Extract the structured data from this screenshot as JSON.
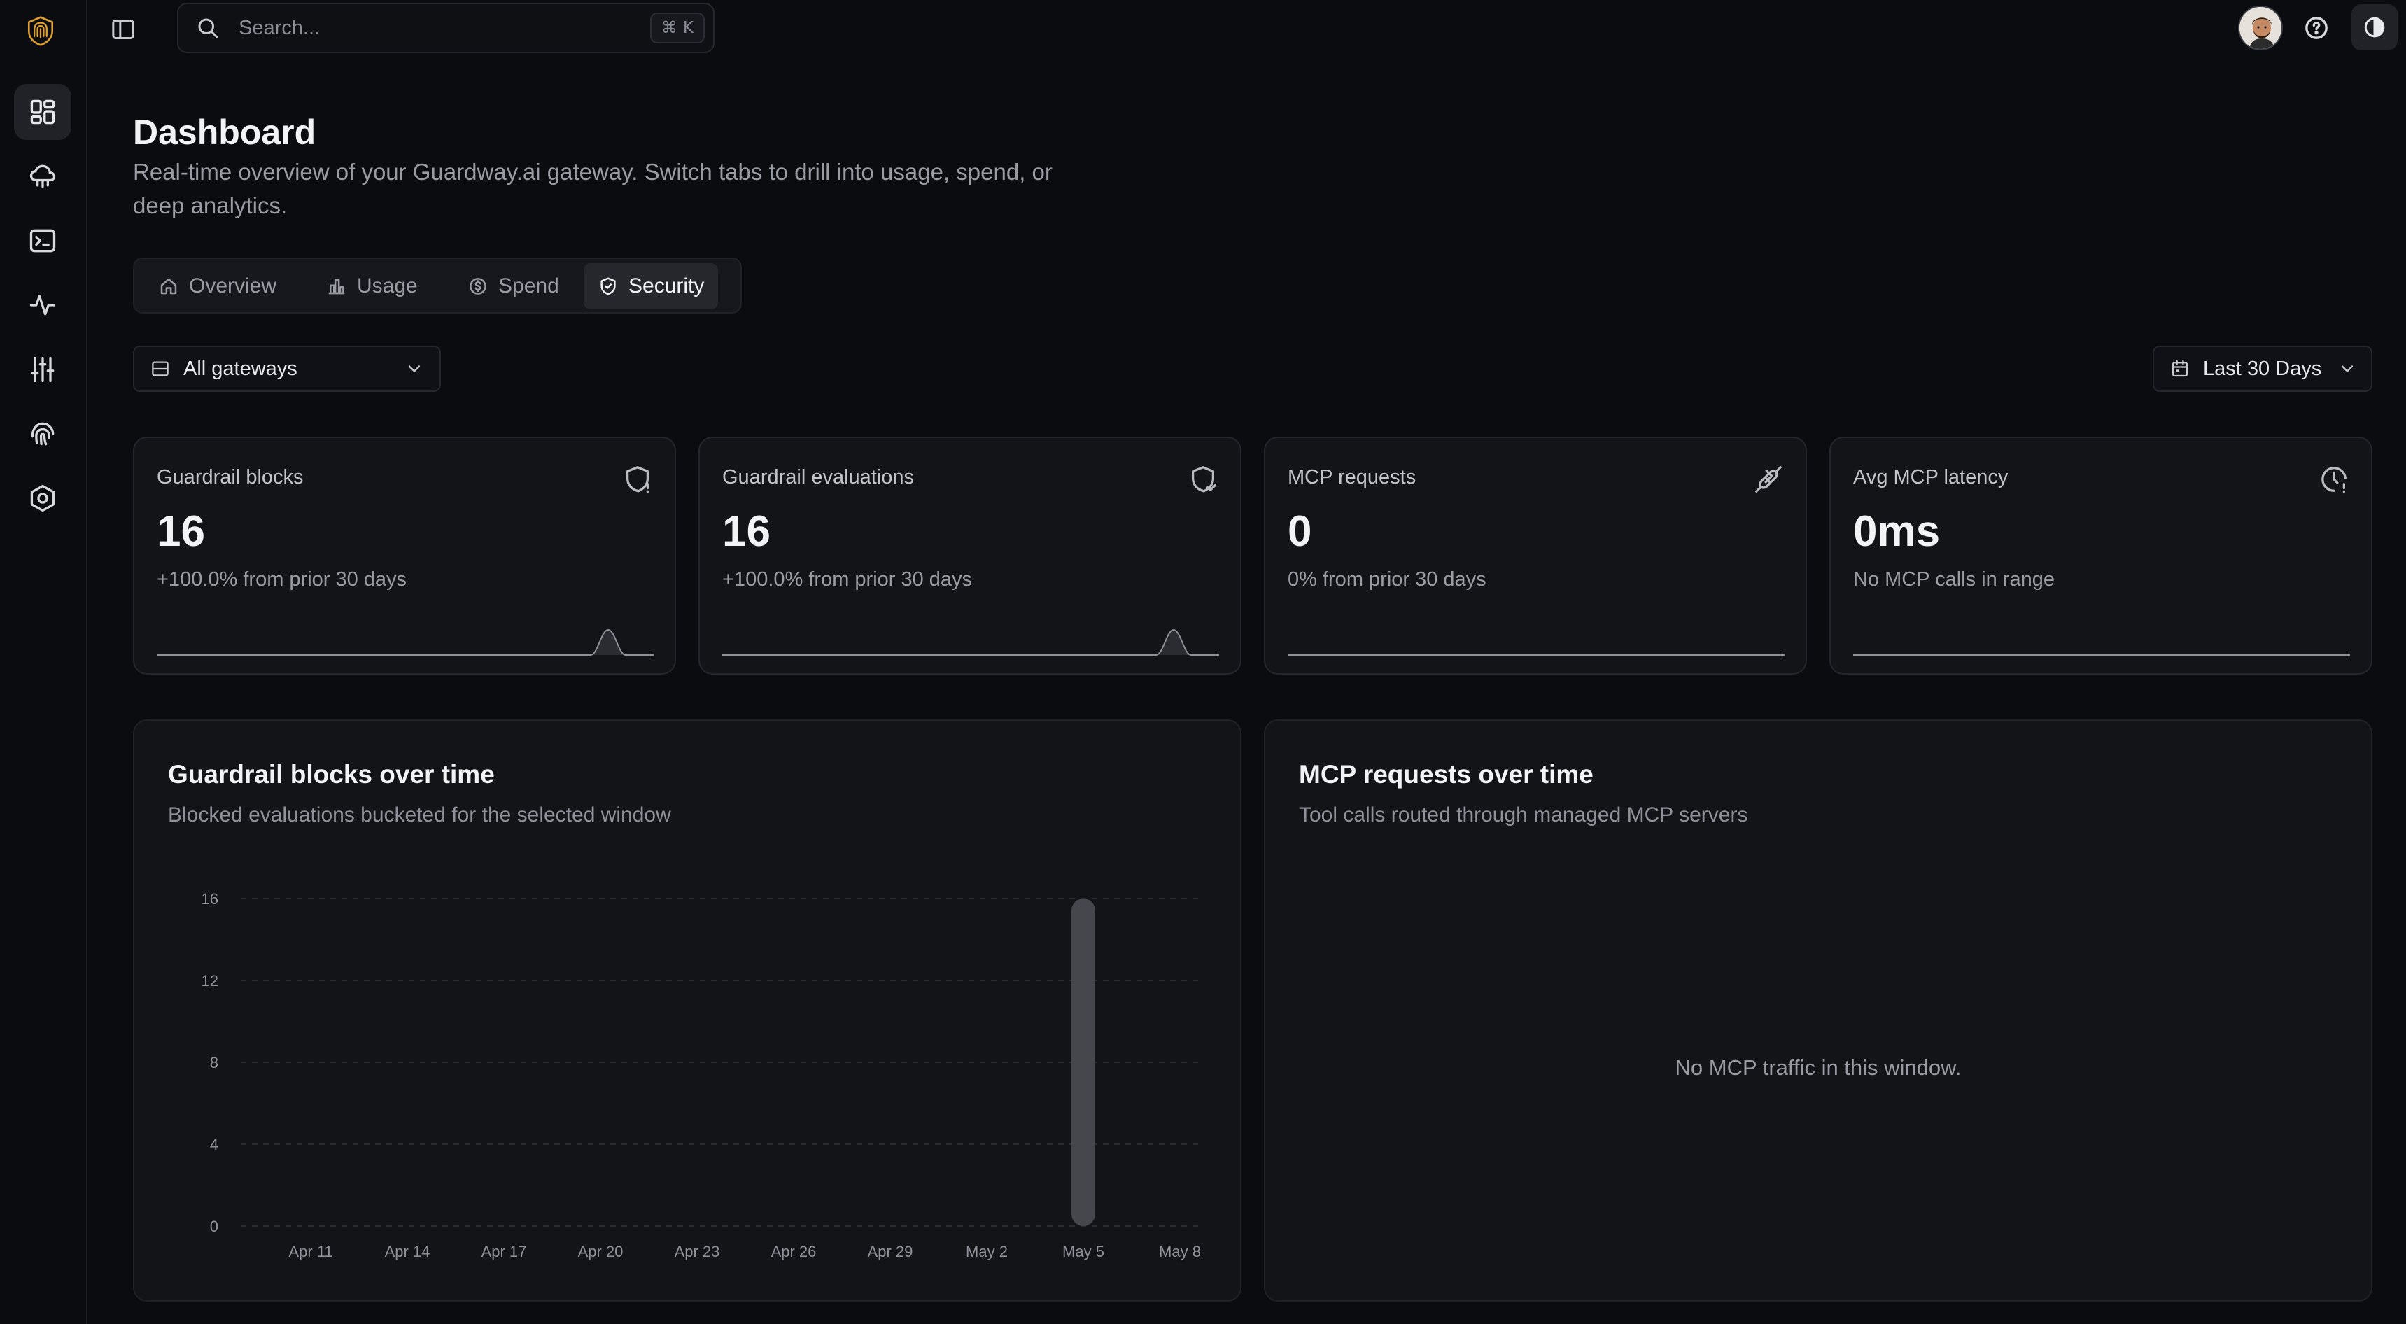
{
  "app": {
    "search_placeholder": "Search...",
    "search_shortcut_symbol": "⌘",
    "search_shortcut_key": "K"
  },
  "nav": {
    "items": [
      {
        "icon": "dashboard-grid-icon",
        "active": true
      },
      {
        "icon": "cloud-network-icon",
        "active": false
      },
      {
        "icon": "terminal-icon",
        "active": false
      },
      {
        "icon": "activity-icon",
        "active": false
      },
      {
        "icon": "sliders-icon",
        "active": false
      },
      {
        "icon": "fingerprint-icon",
        "active": false
      },
      {
        "icon": "hexagon-settings-icon",
        "active": false
      }
    ]
  },
  "header": {
    "title": "Dashboard",
    "subtitle": "Real-time overview of your Guardway.ai gateway. Switch tabs to drill into usage, spend, or deep analytics."
  },
  "tabs": [
    {
      "label": "Overview",
      "icon": "home-icon",
      "active": false
    },
    {
      "label": "Usage",
      "icon": "bar-chart-icon",
      "active": false
    },
    {
      "label": "Spend",
      "icon": "dollar-circle-icon",
      "active": false
    },
    {
      "label": "Security",
      "icon": "shield-icon",
      "active": true
    }
  ],
  "filters": {
    "gateway": "All gateways",
    "date_range": "Last 30 Days"
  },
  "kpis": [
    {
      "label": "Guardrail blocks",
      "value": "16",
      "delta": "+100.0% from prior 30 days",
      "icon": "shield-alert-icon"
    },
    {
      "label": "Guardrail evaluations",
      "value": "16",
      "delta": "+100.0% from prior 30 days",
      "icon": "shield-check-icon"
    },
    {
      "label": "MCP requests",
      "value": "0",
      "delta": "0% from prior 30 days",
      "icon": "plug-icon"
    },
    {
      "label": "Avg MCP latency",
      "value": "0ms",
      "delta": "No MCP calls in range",
      "icon": "clock-alert-icon"
    }
  ],
  "panels": {
    "blocks": {
      "title": "Guardrail blocks over time",
      "subtitle": "Blocked evaluations bucketed for the selected window"
    },
    "mcp": {
      "title": "MCP requests over time",
      "subtitle": "Tool calls routed through managed MCP servers",
      "empty_message": "No MCP traffic in this window."
    }
  },
  "colors": {
    "background": "#0b0c0f",
    "card": "#131418",
    "accent_logo": "#e0a030",
    "bar": "#45474d"
  },
  "chart_data": [
    {
      "type": "bar",
      "title": "Guardrail blocks over time",
      "categories": [
        "Apr 11",
        "Apr 14",
        "Apr 17",
        "Apr 20",
        "Apr 23",
        "Apr 26",
        "Apr 29",
        "May 2",
        "May 5",
        "May 8"
      ],
      "values": [
        0,
        0,
        0,
        0,
        0,
        0,
        0,
        0,
        16,
        0
      ],
      "yticks": [
        0,
        4,
        8,
        12,
        16
      ],
      "ylim": [
        0,
        16
      ],
      "grid": true,
      "legend": "none"
    },
    {
      "type": "line",
      "title": "MCP requests over time",
      "series": [],
      "empty": true
    }
  ]
}
